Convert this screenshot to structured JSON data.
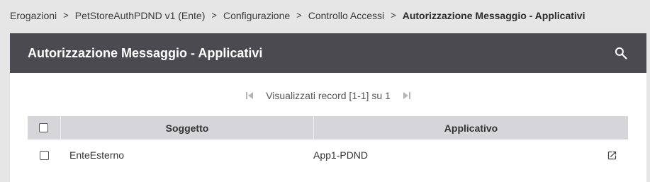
{
  "breadcrumb": {
    "items": [
      "Erogazioni",
      "PetStoreAuthPDND v1 (Ente)",
      "Configurazione",
      "Controllo Accessi"
    ],
    "current": "Autorizzazione Messaggio - Applicativi",
    "separator": ">"
  },
  "panel": {
    "title": "Autorizzazione Messaggio - Applicativi",
    "search_icon": "search-icon"
  },
  "pager": {
    "info": "Visualizzati record [1-1] su 1",
    "first_icon": "first-page-icon",
    "last_icon": "last-page-icon"
  },
  "table": {
    "columns": [
      "Soggetto",
      "Applicativo"
    ],
    "rows": [
      {
        "soggetto": "EnteEsterno",
        "applicativo": "App1-PDND",
        "action_icon": "open-in-new-icon"
      }
    ]
  },
  "colors": {
    "header_bg": "#4a4a50",
    "table_header_bg": "#d5d5da",
    "page_bg": "#e6e6e6"
  }
}
